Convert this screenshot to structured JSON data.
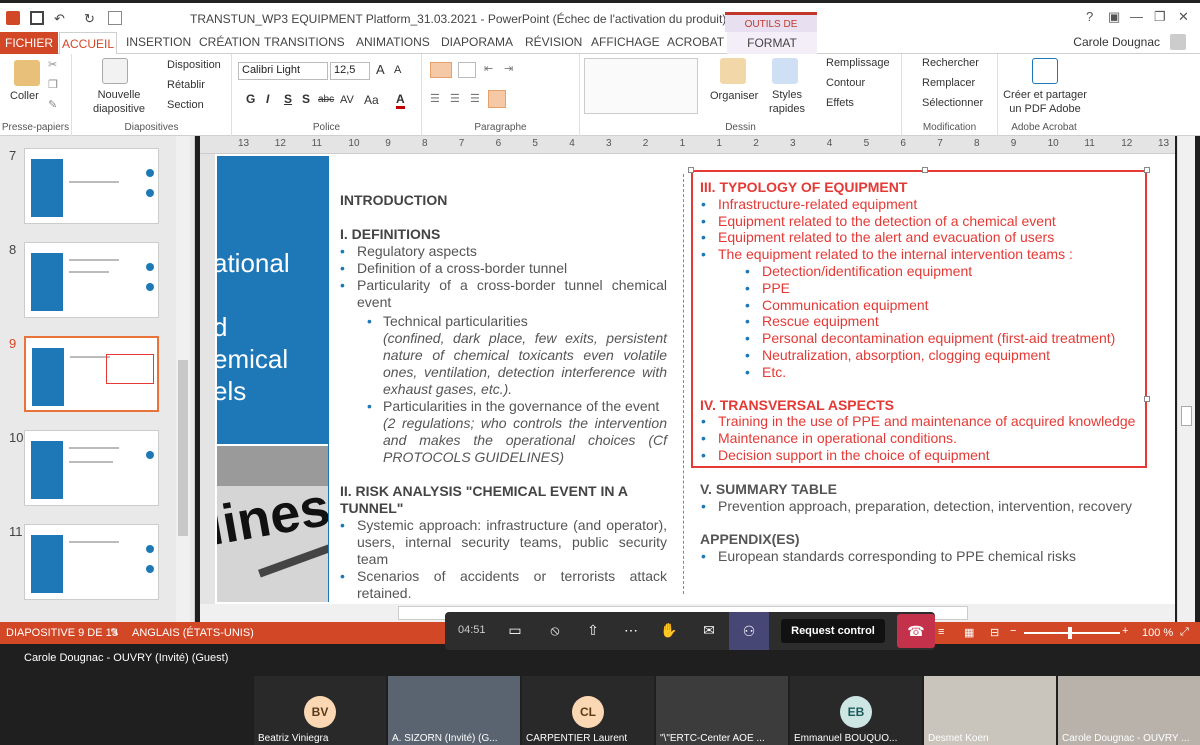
{
  "titlebar": {
    "title": "TRANSTUN_WP3 EQUIPMENT Platform_31.03.2021 - PowerPoint (Échec de l'activation du produit)",
    "context_tab": "OUTILS DE DESSIN"
  },
  "tabs": [
    "FICHIER",
    "ACCUEIL",
    "INSERTION",
    "CRÉATION",
    "TRANSITIONS",
    "ANIMATIONS",
    "DIAPORAMA",
    "RÉVISION",
    "AFFICHAGE",
    "ACROBAT",
    "FORMAT"
  ],
  "user": "Carole Dougnac",
  "ribbon": {
    "presse": {
      "coller": "Coller",
      "label": "Presse-papiers"
    },
    "diapos": {
      "nouvelle": "Nouvelle diapositive",
      "disposition": "Disposition",
      "retablir": "Rétablir",
      "section": "Section",
      "label": "Diapositives"
    },
    "police": {
      "font": "Calibri Light",
      "size": "12,5",
      "label": "Police",
      "bold": "G",
      "italic": "I",
      "underline": "S",
      "shadow": "S",
      "strike": "abc",
      "spacing": "AV",
      "case": "Aa",
      "color": "A",
      "grow": "A",
      "shrink": "A"
    },
    "paragraphe": {
      "label": "Paragraphe"
    },
    "dessin": {
      "organiser": "Organiser",
      "styles": "Styles rapides",
      "remplissage": "Remplissage",
      "contour": "Contour",
      "effets": "Effets",
      "label": "Dessin"
    },
    "modification": {
      "rechercher": "Rechercher",
      "remplacer": "Remplacer",
      "selectionner": "Sélectionner",
      "label": "Modification"
    },
    "acrobat": {
      "creer": "Créer et partager un PDF Adobe",
      "label": "Adobe Acrobat"
    }
  },
  "ruler": [
    "13",
    "12",
    "11",
    "10",
    "9",
    "8",
    "7",
    "6",
    "5",
    "4",
    "3",
    "2",
    "1",
    "1",
    "2",
    "3",
    "4",
    "5",
    "6",
    "7",
    "8",
    "9",
    "10",
    "11",
    "12",
    "13"
  ],
  "thumbnails": [
    {
      "num": "7"
    },
    {
      "num": "8"
    },
    {
      "num": "9"
    },
    {
      "num": "10"
    },
    {
      "num": "11"
    }
  ],
  "slide": {
    "blue_text": [
      "ational",
      "d",
      "emical",
      "els"
    ],
    "photo_word": "lines",
    "left": {
      "intro": "INTRODUCTION",
      "h1": "I. DEFINITIONS",
      "b1": "Regulatory aspects",
      "b2": "Definition of a cross-border tunnel",
      "b3": "Particularity of a cross-border tunnel chemical event",
      "s1": "Technical particularities",
      "s1i": "(confined, dark place, few exits, persistent nature of chemical toxicants even volatile ones, ventilation, detection interference with exhaust gases, etc.).",
      "s2": "Particularities in the governance of the event",
      "s2i": "(2 regulations; who controls the intervention and makes the operational choices (Cf PROTOCOLS GUIDELINES)",
      "h2": "II. RISK ANALYSIS \"CHEMICAL EVENT IN A TUNNEL\"",
      "b4": "Systemic approach: infrastructure (and operator), users, internal security teams, public security team",
      "b5": "Scenarios of accidents or terrorists attack retained."
    },
    "right": {
      "h3": "III. TYPOLOGY OF EQUIPMENT",
      "items": [
        "Infrastructure-related equipment",
        "Equipment related to the detection of a chemical event",
        "Equipment related to the alert and evacuation of users",
        "The equipment related to the internal intervention teams :"
      ],
      "subitems": [
        "Detection/identification equipment",
        "PPE",
        "Communication equipment",
        "Rescue equipment",
        "Personal decontamination equipment (first-aid treatment)",
        "Neutralization, absorption, clogging equipment",
        "Etc."
      ],
      "h4": "IV. TRANSVERSAL ASPECTS",
      "items4": [
        "Training in the use of PPE and maintenance of acquired knowledge",
        "Maintenance in operational conditions.",
        "Decision support in the choice of equipment"
      ],
      "h5": "V. SUMMARY TABLE",
      "b5": "Prevention approach, preparation, detection, intervention, recovery",
      "h6": "APPENDIX(ES)",
      "b6": "European standards corresponding to PPE chemical risks"
    }
  },
  "status": {
    "slide": "DIAPOSITIVE 9 DE 13",
    "lang": "ANGLAIS (ÉTATS-UNIS)",
    "zoom": "100 %"
  },
  "meeting": {
    "timer": "04:51",
    "request": "Request control"
  },
  "presenter": "Carole Dougnac - OUVRY (Invité) (Guest)",
  "participants": [
    {
      "initials": "BV",
      "name": "Beatriz Viniegra",
      "photo": false
    },
    {
      "initials": "",
      "name": "A. SIZORN (Invité) (G...",
      "photo": true
    },
    {
      "initials": "CL",
      "name": "CARPENTIER Laurent",
      "photo": false
    },
    {
      "initials": "",
      "name": "\"\\\"ERTC-Center AOE ...",
      "photo": true
    },
    {
      "initials": "EB",
      "name": "Emmanuel BOUQUO...",
      "photo": false
    },
    {
      "initials": "",
      "name": "Desmet Koen",
      "photo": true
    },
    {
      "initials": "",
      "name": "Carole Dougnac - OUVRY ...",
      "photo": true
    }
  ]
}
